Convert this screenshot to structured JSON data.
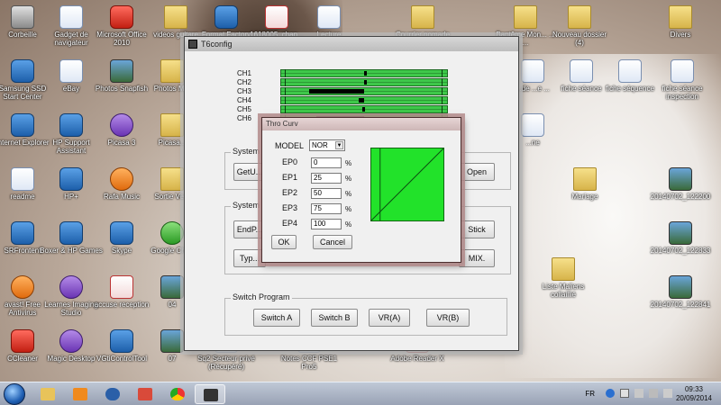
{
  "desktop": {
    "icons": [
      {
        "label": "Corbeille",
        "icon": "recycle-bin-icon"
      },
      {
        "label": "Gadget de navigateur",
        "icon": "doc-icon"
      },
      {
        "label": "Microsoft Office 2010",
        "icon": "office-icon"
      },
      {
        "label": "videos guitare",
        "icon": "folder-icon"
      },
      {
        "label": "Format Factory",
        "icon": "app-icon"
      },
      {
        "label": "1618005_chap...",
        "icon": "pdf-icon"
      },
      {
        "label": "Lecture",
        "icon": "word-icon"
      },
      {
        "label": "Courrier nomade",
        "icon": "folder-icon"
      },
      {
        "label": "Baptême Mon... ... ...",
        "icon": "folder-icon"
      },
      {
        "label": "Nouveau dossier (4)",
        "icon": "folder-icon"
      },
      {
        "label": "Divers",
        "icon": "folder-icon"
      },
      {
        "label": "Samsung SSD Start Center",
        "icon": "app-icon"
      },
      {
        "label": "eBay",
        "icon": "ebay-icon"
      },
      {
        "label": "Photos Snapfish",
        "icon": "photo-icon"
      },
      {
        "label": "Photos M...",
        "icon": "folder-icon"
      },
      {
        "label": "...de ...e ...",
        "icon": "doc-icon"
      },
      {
        "label": "fiche séance",
        "icon": "word-icon"
      },
      {
        "label": "fiche séquence",
        "icon": "word-icon"
      },
      {
        "label": "fiche séance inspection",
        "icon": "word-icon"
      },
      {
        "label": "Internet Explorer",
        "icon": "ie-icon"
      },
      {
        "label": "HP Support Assistant",
        "icon": "help-icon"
      },
      {
        "label": "Picasa 3",
        "icon": "picasa-icon"
      },
      {
        "label": "Picasa...",
        "icon": "folder-icon"
      },
      {
        "label": "...ne",
        "icon": "doc-icon"
      },
      {
        "label": "readme",
        "icon": "doc-icon"
      },
      {
        "label": "HP+",
        "icon": "hp-icon"
      },
      {
        "label": "Rafa Music",
        "icon": "music-icon"
      },
      {
        "label": "Sortie Ve...",
        "icon": "folder-icon"
      },
      {
        "label": "Mariage",
        "icon": "folder-icon"
      },
      {
        "label": "20140702_122200",
        "icon": "photo-icon"
      },
      {
        "label": "SRFrontent",
        "icon": "app-icon"
      },
      {
        "label": "Boxer & HP Games",
        "icon": "games-icon"
      },
      {
        "label": "Skype",
        "icon": "skype-icon"
      },
      {
        "label": "Google Chr...",
        "icon": "chrome-icon"
      },
      {
        "label": "20140702_122833",
        "icon": "photo-icon"
      },
      {
        "label": "Liste Maliens collaillié",
        "icon": "folder-icon"
      },
      {
        "label": "avast! Free Antivirus",
        "icon": "avast-icon"
      },
      {
        "label": "Learnes Imaging Studio",
        "icon": "imaging-icon"
      },
      {
        "label": "accuse reception",
        "icon": "pdf-icon"
      },
      {
        "label": "04",
        "icon": "photo-icon"
      },
      {
        "label": "20140702_122841",
        "icon": "photo-icon"
      },
      {
        "label": "CCleaner",
        "icon": "ccleaner-icon"
      },
      {
        "label": "Magic Desktop",
        "icon": "magic-icon"
      },
      {
        "label": "VGtiControlTool",
        "icon": "app-icon"
      },
      {
        "label": "07",
        "icon": "photo-icon"
      },
      {
        "label": "Sq2 Secteur privé (Récupéré)",
        "icon": "doc-icon"
      },
      {
        "label": "Notes CCF PSE1 Pro5",
        "icon": "doc-icon"
      },
      {
        "label": "Adobe Reader X",
        "icon": "pdf-icon"
      }
    ]
  },
  "window": {
    "title": "T6config",
    "channels": [
      {
        "label": "CH1",
        "value": 0.5
      },
      {
        "label": "CH2",
        "value": 0.5
      },
      {
        "label": "CH3",
        "value": 0.17
      },
      {
        "label": "CH4",
        "value": 0.47
      },
      {
        "label": "CH5",
        "value": 0.49
      },
      {
        "label": "CH6",
        "value": 0.21
      }
    ],
    "system_group_label": "System C...",
    "getuser_button": "GetU...",
    "open_button": "Open",
    "system_setup_label": "System Se...",
    "endpoint_button": "EndP...",
    "stick_button": "Stick",
    "type_button": "Typ...",
    "mix_button": "MIX.",
    "switch_program_label": "Switch Program",
    "switch_a_button": "Switch A",
    "switch_b_button": "Switch B",
    "vra_button": "VR(A)",
    "vrb_button": "VR(B)"
  },
  "dialog": {
    "title": "Thro Curv",
    "model_label": "MODEL",
    "model_value": "NOR",
    "points": [
      {
        "label": "EP0",
        "value": "0"
      },
      {
        "label": "EP1",
        "value": "25"
      },
      {
        "label": "EP2",
        "value": "50"
      },
      {
        "label": "EP3",
        "value": "75"
      },
      {
        "label": "EP4",
        "value": "100"
      }
    ],
    "percent": "%",
    "ok_label": "OK",
    "cancel_label": "Cancel",
    "curve_color": "#22e22a"
  },
  "taskbar": {
    "language": "FR",
    "time": "09:33",
    "date": "20/09/2014"
  }
}
